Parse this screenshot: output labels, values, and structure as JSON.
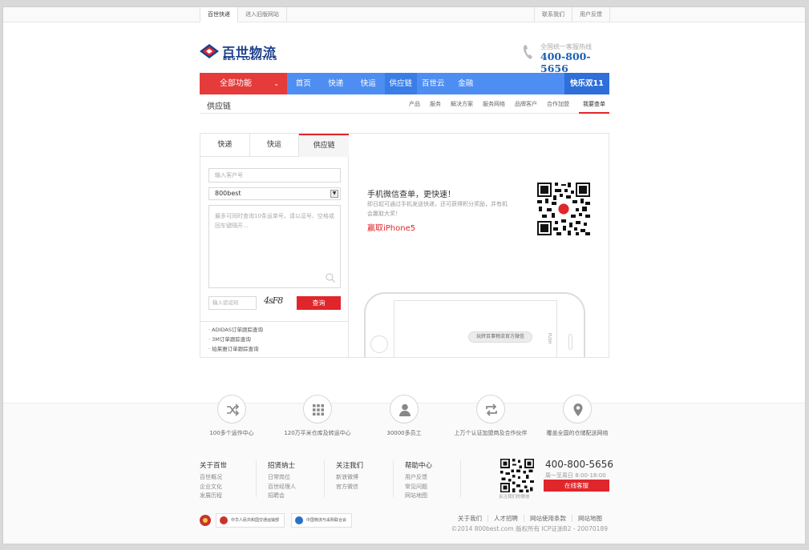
{
  "topbar": {
    "left": [
      "百世快递",
      "进入旧版网站"
    ],
    "right": [
      "联系我们",
      "用户反馈"
    ]
  },
  "logo": {
    "cn": "百世物流",
    "en": "BEST LOGISTICS"
  },
  "hotline": {
    "label": "全国统一客服热线",
    "number": "400-800-5656"
  },
  "nav": {
    "all": "全部功能",
    "items": [
      "首页",
      "快递",
      "快运",
      "供应链",
      "百世云",
      "金融"
    ],
    "active_index": 3,
    "promo": "快乐双11"
  },
  "subnav": {
    "title": "供应链",
    "links": [
      "产品",
      "服务",
      "解决方案",
      "服务网络",
      "品牌客户",
      "合作加盟",
      "我要查单"
    ]
  },
  "tracker": {
    "tabs": [
      "快递",
      "快运",
      "供应链"
    ],
    "active_tab": 2,
    "customer_placeholder": "输入客户号",
    "select_value": "800best",
    "textarea_placeholder": "最多可同时查询10条运单号，请以逗号、空格或回车键隔开...",
    "code_placeholder": "输入验证码",
    "captcha": "4sF8",
    "query_label": "查询",
    "quick_links": [
      "· ADIDAS订单跟踪查询",
      "· 3M订单跟踪查询",
      "· 珀莱雅订单跟踪查询"
    ]
  },
  "promo": {
    "title": "手机微信查单，更快速！",
    "desc": "即日起可通过手机发送快递，还可获得积分奖励，并有机会赢取大奖！",
    "prize": "赢取iPhone5",
    "phone_label": "玩转百事物流官方微信",
    "phone_side": "PUSH"
  },
  "features": [
    {
      "icon": "shuffle-icon",
      "text": "100多个运作中心"
    },
    {
      "icon": "grid-icon",
      "text": "120万平米仓库及转运中心"
    },
    {
      "icon": "person-icon",
      "text": "30000多员工"
    },
    {
      "icon": "repeat-icon",
      "text": "上万个认证加盟商及合作伙伴"
    },
    {
      "icon": "location-icon",
      "text": "覆盖全国的仓储配送网络"
    }
  ],
  "footer": {
    "columns": [
      {
        "heading": "关于百世",
        "links": [
          "百世概况",
          "企业文化",
          "发展历程"
        ]
      },
      {
        "heading": "招贤纳士",
        "links": [
          "日常岗位",
          "百世经理人",
          "招聘会"
        ]
      },
      {
        "heading": "关注我们",
        "links": [
          "新浪微博",
          "官方微信"
        ]
      },
      {
        "heading": "帮助中心",
        "links": [
          "用户反馈",
          "常见问题",
          "网站地图"
        ]
      }
    ],
    "qr_caption": "关注我们的微信",
    "phone": "400-800-5656",
    "hours": "周一至周日 8:00-18:00",
    "service_button": "在线客服",
    "badges": [
      "中华人民共和国交通运输部",
      "中国物流与采购联合会"
    ],
    "links": [
      "关于我们",
      "人才招聘",
      "网站使用条款",
      "网站地图"
    ],
    "copyright": "©2014 800best.com 版权所有  ICP证浙B2 - 20070189"
  },
  "colors": {
    "brand_blue": "#4e8ef2",
    "brand_red": "#e0262b",
    "logo_navy": "#1c3f8c"
  }
}
